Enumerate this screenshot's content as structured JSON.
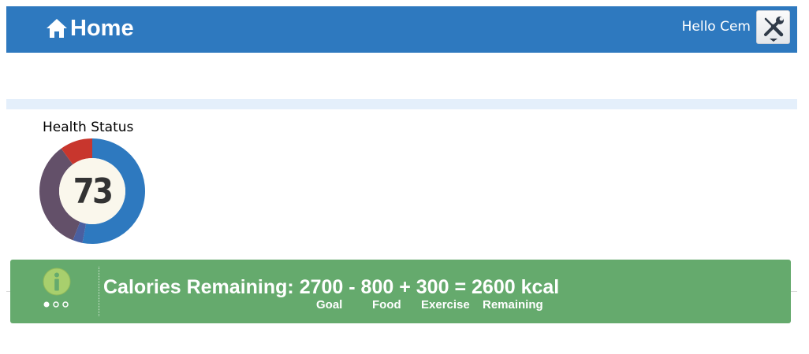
{
  "header": {
    "title": "Home",
    "home_icon": "home-icon",
    "greeting": "Hello Cem",
    "settings_icon": "tools-icon",
    "background_color": "#2e79bf"
  },
  "health": {
    "label": "Health Status",
    "score": "73",
    "segments": [
      {
        "name": "blue",
        "color": "#2e79bf",
        "fraction": 0.53
      },
      {
        "name": "navy",
        "color": "#4a5fa0",
        "fraction": 0.03
      },
      {
        "name": "purple",
        "color": "#635069",
        "fraction": 0.34
      },
      {
        "name": "red",
        "color": "#c8362d",
        "fraction": 0.1
      }
    ]
  },
  "calories": {
    "heading": "Calories Remaining:",
    "goal_value": "2700",
    "op_minus": "-",
    "food_value": "800",
    "op_plus": "+",
    "exercise_value": "300",
    "op_equals": "=",
    "remaining_value": "2600 kcal",
    "goal_label": "Goal",
    "food_label": "Food",
    "exercise_label": "Exercise",
    "remaining_label": "Remaining",
    "info_icon": "info-icon",
    "pager_dots": 3,
    "pager_active": 0,
    "panel_color": "#65aa6d"
  }
}
